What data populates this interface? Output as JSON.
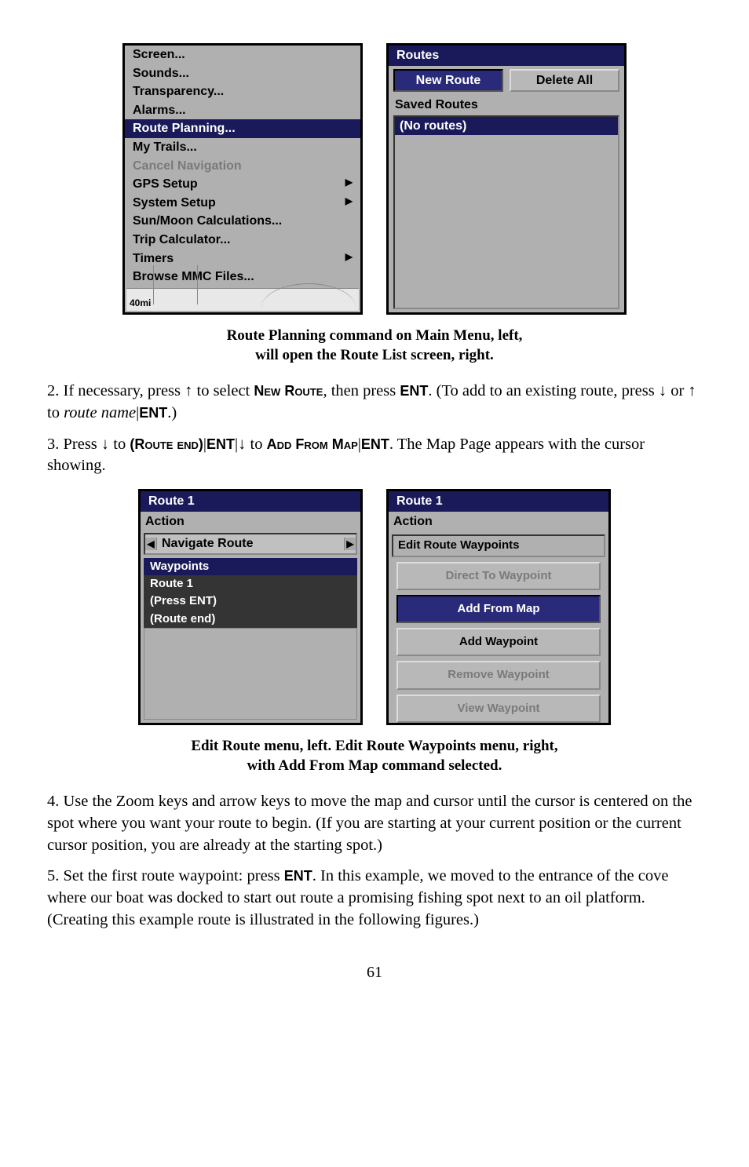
{
  "fig1": {
    "menu": {
      "items": [
        {
          "label": "Screen...",
          "state": "normal"
        },
        {
          "label": "Sounds...",
          "state": "normal"
        },
        {
          "label": "Transparency...",
          "state": "normal"
        },
        {
          "label": "Alarms...",
          "state": "normal"
        },
        {
          "label": "Route Planning...",
          "state": "highlight"
        },
        {
          "label": "My Trails...",
          "state": "normal"
        },
        {
          "label": "Cancel Navigation",
          "state": "disabled"
        },
        {
          "label": "GPS Setup",
          "state": "submenu"
        },
        {
          "label": "System Setup",
          "state": "submenu"
        },
        {
          "label": "Sun/Moon Calculations...",
          "state": "normal"
        },
        {
          "label": "Trip Calculator...",
          "state": "normal"
        },
        {
          "label": "Timers",
          "state": "submenu"
        },
        {
          "label": "Browse MMC Files...",
          "state": "normal"
        }
      ],
      "scale": "40mi"
    },
    "routes": {
      "title": "Routes",
      "new_route": "New Route",
      "delete_all": "Delete All",
      "saved_routes": "Saved Routes",
      "no_routes": "(No routes)"
    },
    "caption_line1": "Route Planning command on Main Menu, left,",
    "caption_line2": "will open the Route List screen, right."
  },
  "para2": {
    "prefix": "2. If necessary, press ↑ to select ",
    "new_route": "New Route",
    "mid": ", then press ",
    "ent": "ENT",
    "tail1": ". (To add to an existing route, press ↓  or ↑ to ",
    "route_name": "route name",
    "tail2": "|",
    "ent2": "ENT",
    "tail3": ".)"
  },
  "para3": {
    "prefix": "3. Press ↓ to ",
    "route_end": "(Route end)",
    "pipe1": "|",
    "ent1": "ENT",
    "pipe2": "|↓ to ",
    "add_from_map": "Add From Map",
    "pipe3": "|",
    "ent2": "ENT",
    "tail": ". The Map Page appears with the cursor showing."
  },
  "fig2": {
    "left": {
      "title": "Route 1",
      "action": "Action",
      "navigate": "Navigate Route",
      "waypoints": "Waypoints",
      "route1": "Route 1",
      "press_ent": "(Press ENT)",
      "route_end": "(Route end)"
    },
    "right": {
      "title": "Route 1",
      "action": "Action",
      "edit_wp": "Edit Route Waypoints",
      "direct": "Direct To Waypoint",
      "add_map": "Add From Map",
      "add_wp": "Add Waypoint",
      "remove": "Remove Waypoint",
      "view": "View Waypoint"
    },
    "caption_line1": "Edit Route menu, left. Edit Route Waypoints menu, right,",
    "caption_line2": "with Add From Map command selected."
  },
  "para4": "4. Use the Zoom keys and arrow keys to move the map and cursor until the cursor is centered on the spot where you want your route to begin. (If you are starting at your current position or the current cursor position, you are already at the starting spot.)",
  "para5": {
    "prefix": "5. Set the first route waypoint: press ",
    "ent": "ENT",
    "tail": ". In this example, we moved to the entrance of the cove where our boat was docked to start out route a promising fishing spot next to an oil platform. (Creating this example route is illustrated in the following figures.)"
  },
  "page_number": "61"
}
